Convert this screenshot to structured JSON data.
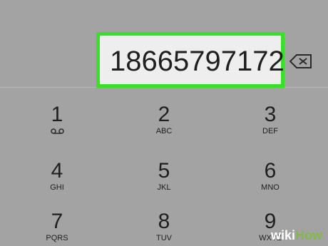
{
  "dialer": {
    "number": "18665797172",
    "backspace_icon": "backspace-icon",
    "keys": [
      {
        "digit": "1",
        "letters": "",
        "icon": "voicemail-icon"
      },
      {
        "digit": "2",
        "letters": "ABC"
      },
      {
        "digit": "3",
        "letters": "DEF"
      },
      {
        "digit": "4",
        "letters": "GHI"
      },
      {
        "digit": "5",
        "letters": "JKL"
      },
      {
        "digit": "6",
        "letters": "MNO"
      },
      {
        "digit": "7",
        "letters": "PQRS"
      },
      {
        "digit": "8",
        "letters": "TUV"
      },
      {
        "digit": "9",
        "letters": "WXYZ"
      }
    ]
  },
  "watermark": {
    "wiki": "wiki",
    "how": "How"
  },
  "colors": {
    "background": "#a3a3a3",
    "highlight": "#38e028",
    "display_background": "#eeeeee",
    "text": "#1f1f1f"
  }
}
